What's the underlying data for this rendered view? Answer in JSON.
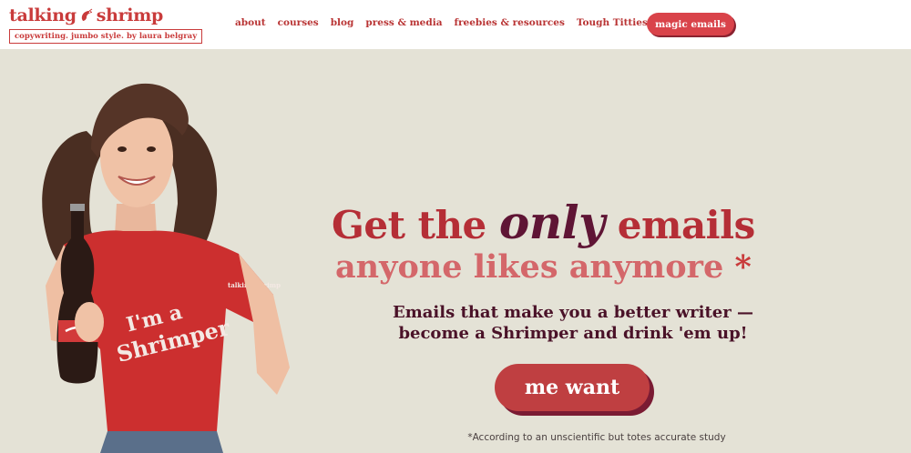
{
  "brand": {
    "name_left": "talking",
    "name_right": "shrimp",
    "tagline": "copywriting. jumbo style. by laura belgray",
    "accent": "#c93b3b"
  },
  "nav": {
    "items": [
      {
        "label": "about"
      },
      {
        "label": "courses"
      },
      {
        "label": "blog"
      },
      {
        "label": "press & media"
      },
      {
        "label": "freebies & resources"
      },
      {
        "label": "Tough Titties"
      }
    ],
    "cta_label": "magic emails"
  },
  "hero": {
    "headline_pre": "Get the",
    "headline_emph": "only",
    "headline_post": "emails",
    "headline_line2": "anyone likes anymore",
    "asterisk": "*",
    "subhead_line1": "Emails that make you a better writer —",
    "subhead_line2": "become a Shrimper and drink 'em up!",
    "cta_label": "me want",
    "footnote": "*According to an unscientific but totes accurate study",
    "shirt_text_1": "I'm a",
    "shirt_text_2": "Shrimper",
    "shirt_logo": "talking shrimp"
  },
  "colors": {
    "background": "#e4e2d6",
    "button": "#bf3f41",
    "button_shadow": "#7a1b33",
    "headline": "#b52e36",
    "headline_emph": "#5f1535",
    "headline_line2": "#d4676a",
    "subhead": "#4a1228"
  }
}
